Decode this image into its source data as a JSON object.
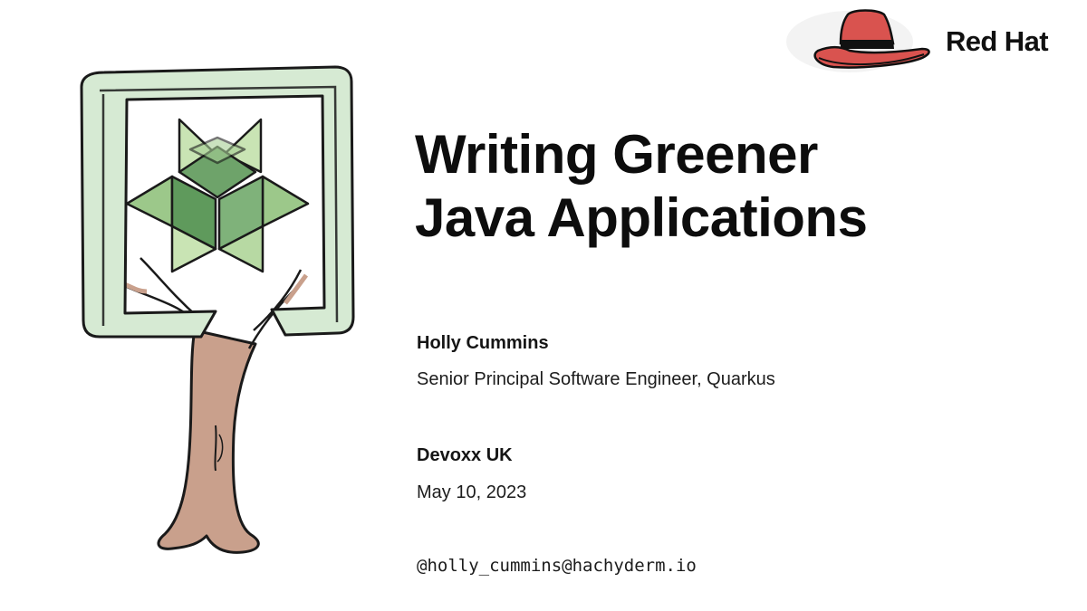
{
  "brand": {
    "logo_text": "Red Hat",
    "logo_icon": "red-fedora-hat-icon",
    "hat_color": "#d9534f"
  },
  "illustration": {
    "icon": "green-tree-logo-icon",
    "frame_color": "#d6ead3",
    "leaf_colors": [
      "#c9e4b4",
      "#8fbf7f",
      "#5f9a5c"
    ],
    "trunk_color": "#c9a08c"
  },
  "slide": {
    "title_line1": "Writing Greener",
    "title_line2": "Java Applications",
    "speaker_name": "Holly Cummins",
    "speaker_role": "Senior Principal Software Engineer, Quarkus",
    "event_name": "Devoxx UK",
    "event_date": "May 10, 2023",
    "handle": "@holly_cummins@hachyderm.io"
  }
}
